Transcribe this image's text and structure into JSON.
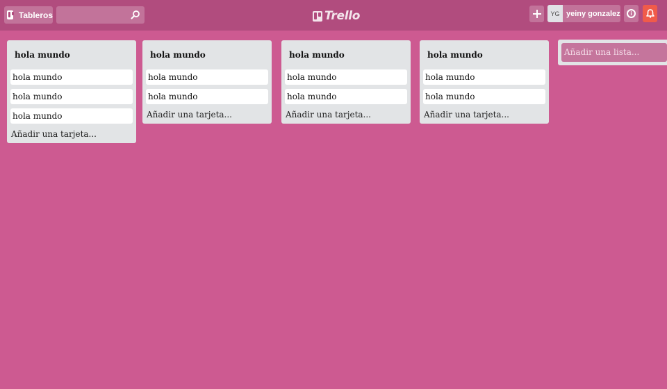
{
  "header": {
    "boards_label": "Tableros",
    "search_value": "",
    "logo_text": "Trello",
    "avatar_initials": "YG",
    "member_name": "yeiny gonzalez",
    "info_glyph": "i"
  },
  "lists": [
    {
      "title": "hola mundo",
      "cards": [
        "hola mundo",
        "hola mundo",
        "hola mundo"
      ],
      "add_card": "Añadir una tarjeta..."
    },
    {
      "title": "hola mundo",
      "cards": [
        "hola mundo",
        "hola mundo"
      ],
      "add_card": "Añadir una tarjeta..."
    },
    {
      "title": "hola mundo",
      "cards": [
        "hola mundo",
        "hola mundo"
      ],
      "add_card": "Añadir una tarjeta..."
    },
    {
      "title": "hola mundo",
      "cards": [
        "hola mundo",
        "hola mundo"
      ],
      "add_card": "Añadir una tarjeta..."
    }
  ],
  "add_list": "Añadir una lista...",
  "colors": {
    "background": "#cd5a91",
    "header": "#b14c7e",
    "list": "#e2e4e6",
    "notification": "#f05b4a"
  },
  "icons": [
    "boards-icon",
    "search-icon",
    "plus-icon",
    "info-icon",
    "bell-icon"
  ]
}
